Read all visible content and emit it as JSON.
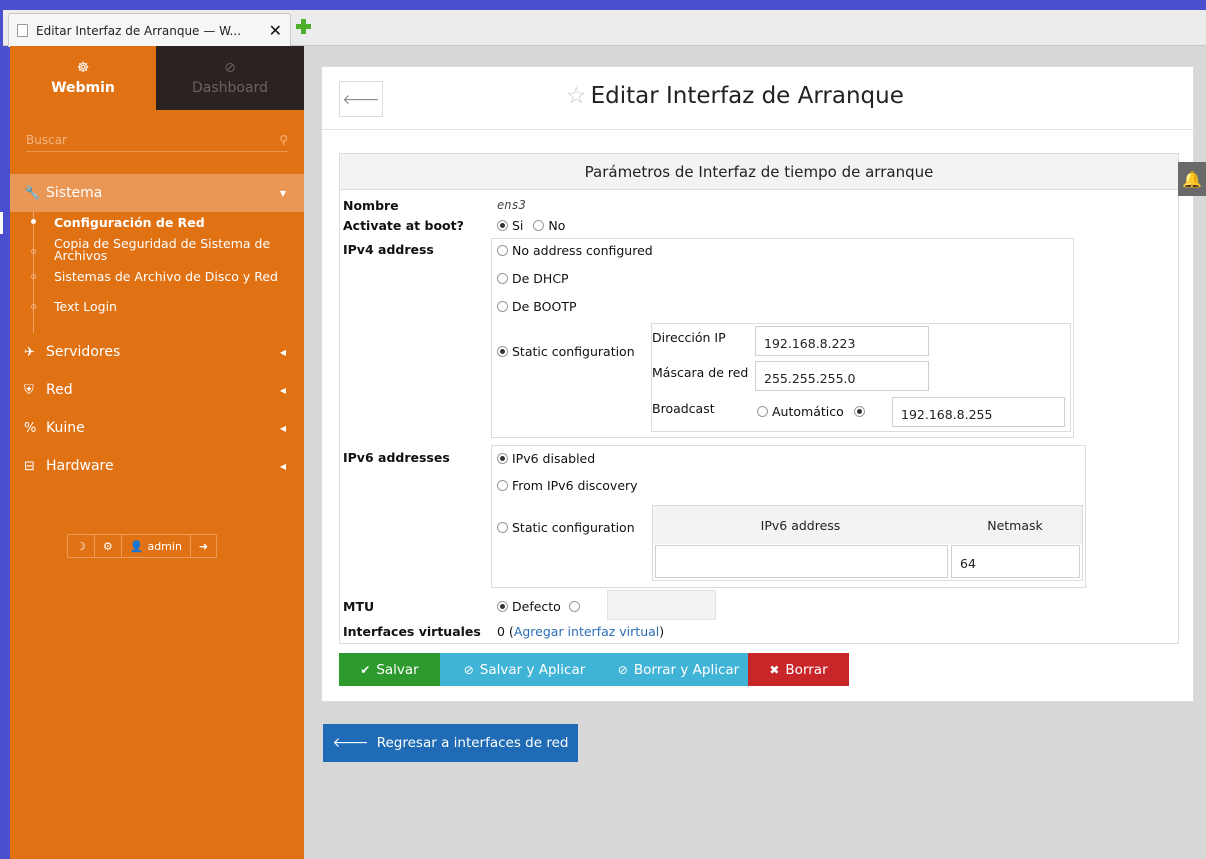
{
  "browser": {
    "tab_title": "Editar Interfaz de Arranque — W...",
    "tab_close": "✕",
    "new_tab": "+"
  },
  "sidebar": {
    "tabs": [
      {
        "label": "Webmin",
        "icon": "☸"
      },
      {
        "label": "Dashboard",
        "icon": "⊘"
      }
    ],
    "search_placeholder": "Buscar",
    "menu": [
      {
        "label": "Sistema",
        "icon": "🔧",
        "expanded": true
      },
      {
        "label": "Servidores",
        "icon": "✈"
      },
      {
        "label": "Red",
        "icon": "⛨"
      },
      {
        "label": "Kuine",
        "icon": "%"
      },
      {
        "label": "Hardware",
        "icon": "⊟"
      }
    ],
    "submenu": [
      {
        "label": "Configuración de Red",
        "current": true
      },
      {
        "label": "Copia de Seguridad de Sistema de Archivos"
      },
      {
        "label": "Sistemas de Archivo de Disco y Red"
      },
      {
        "label": "Text Login"
      }
    ],
    "footer": {
      "user": "admin"
    }
  },
  "page": {
    "title": "Editar Interfaz de Arranque",
    "section_title": "Parámetros de Interfaz de tiempo de arranque",
    "fields": {
      "name_label": "Nombre",
      "name_value": "ens3",
      "boot_label": "Activate at boot?",
      "boot_yes": "Si",
      "boot_no": "No",
      "ipv4_label": "IPv4 address",
      "ipv4_none": "No address configured",
      "ipv4_dhcp": "De DHCP",
      "ipv4_bootp": "De BOOTP",
      "ipv4_static": "Static configuration",
      "ip_label": "Dirección IP",
      "ip_value": "192.168.8.223",
      "mask_label": "Máscara de red",
      "mask_value": "255.255.255.0",
      "bcast_label": "Broadcast",
      "bcast_auto": "Automático",
      "bcast_value": "192.168.8.255",
      "ipv6_label": "IPv6 addresses",
      "ipv6_disabled": "IPv6 disabled",
      "ipv6_discovery": "From IPv6 discovery",
      "ipv6_static": "Static configuration",
      "ipv6_col_address": "IPv6 address",
      "ipv6_col_netmask": "Netmask",
      "ipv6_address_value": "",
      "ipv6_netmask_value": "64",
      "mtu_label": "MTU",
      "mtu_default": "Defecto",
      "mtu_value": "",
      "virtual_label": "Interfaces virtuales",
      "virtual_count": "0",
      "virtual_link": "Agregar interfaz virtual"
    },
    "buttons": {
      "save": "Salvar",
      "save_apply": "Salvar y Aplicar",
      "delete_apply": "Borrar y Aplicar",
      "delete": "Borrar"
    },
    "return_button": "Regresar a interfaces de red"
  },
  "colors": {
    "sidebar": "#e07214",
    "save": "#2d9a2d",
    "apply": "#40b4d6",
    "delete": "#c9262a",
    "return": "#1f6bb5"
  }
}
